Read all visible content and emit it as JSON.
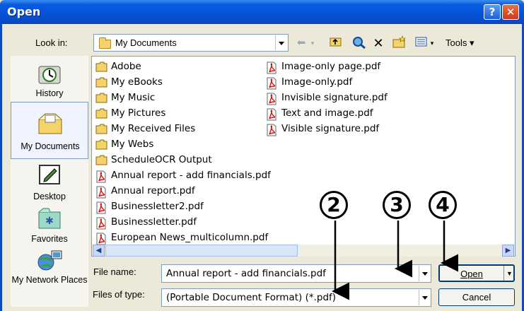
{
  "window": {
    "title": "Open",
    "help_label": "?",
    "close_label": "✕"
  },
  "toolbar": {
    "look_in_label": "Look in:",
    "look_in_value": "My Documents",
    "tools_label": "Tools"
  },
  "places": [
    {
      "label": "History",
      "icon": "history-icon"
    },
    {
      "label": "My Documents",
      "icon": "my-documents-icon"
    },
    {
      "label": "Desktop",
      "icon": "desktop-icon"
    },
    {
      "label": "Favorites",
      "icon": "favorites-icon"
    },
    {
      "label": "My Network Places",
      "icon": "network-places-icon"
    }
  ],
  "files_col1": [
    {
      "name": "Adobe",
      "type": "folder"
    },
    {
      "name": "My eBooks",
      "type": "folder"
    },
    {
      "name": "My Music",
      "type": "folder"
    },
    {
      "name": "My Pictures",
      "type": "folder"
    },
    {
      "name": "My Received Files",
      "type": "folder"
    },
    {
      "name": "My Webs",
      "type": "folder"
    },
    {
      "name": "ScheduleOCR Output",
      "type": "folder"
    },
    {
      "name": "Annual report - add financials.pdf",
      "type": "pdf"
    },
    {
      "name": "Annual report.pdf",
      "type": "pdf"
    },
    {
      "name": "Businessletter2.pdf",
      "type": "pdf"
    },
    {
      "name": "Businessletter.pdf",
      "type": "pdf"
    },
    {
      "name": "European News_multicolumn.pdf",
      "type": "pdf"
    }
  ],
  "files_col2": [
    {
      "name": "Image-only page.pdf",
      "type": "pdf"
    },
    {
      "name": "Image-only.pdf",
      "type": "pdf"
    },
    {
      "name": "Invisible signature.pdf",
      "type": "pdf"
    },
    {
      "name": "Text and image.pdf",
      "type": "pdf"
    },
    {
      "name": "Visible signature.pdf",
      "type": "pdf"
    }
  ],
  "form": {
    "file_name_label": "File name:",
    "file_name_value": "Annual report - add financials.pdf",
    "file_type_label": "Files of type:",
    "file_type_value": "(Portable Document Format) (*.pdf)",
    "open_label": "Open",
    "cancel_label": "Cancel"
  },
  "callouts": [
    "2",
    "3",
    "4"
  ]
}
